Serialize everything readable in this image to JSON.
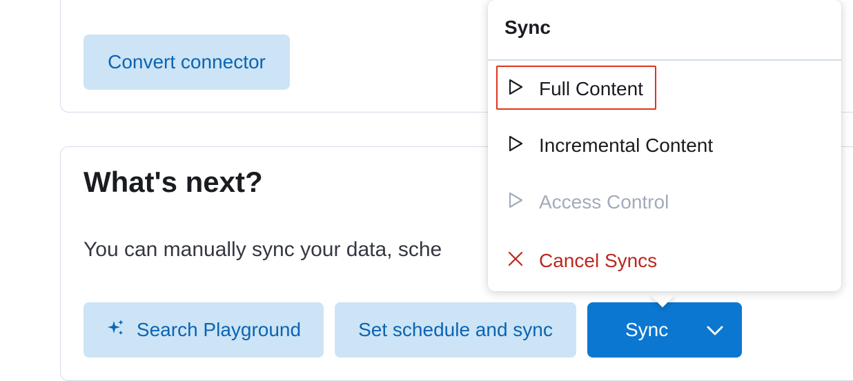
{
  "connector_panel": {
    "convert_label": "Convert connector"
  },
  "whats_next": {
    "title": "What's next?",
    "description": "You can manually sync your data, sche",
    "search_playground_label": "Search Playground",
    "schedule_label": "Set schedule and sync",
    "sync_label": "Sync"
  },
  "sync_menu": {
    "title": "Sync",
    "items": [
      {
        "label": "Full Content",
        "icon": "play-icon",
        "state": "enabled"
      },
      {
        "label": "Incremental Content",
        "icon": "play-icon",
        "state": "enabled"
      },
      {
        "label": "Access Control",
        "icon": "play-icon",
        "state": "disabled"
      },
      {
        "label": "Cancel Syncs",
        "icon": "cross-icon",
        "state": "danger"
      }
    ]
  },
  "colors": {
    "primary": "#0b77d0",
    "light_button": "#cce4f5",
    "link_text": "#0b64b4",
    "danger": "#bd271e",
    "disabled": "#a2abba",
    "highlight": "#e0331c"
  }
}
